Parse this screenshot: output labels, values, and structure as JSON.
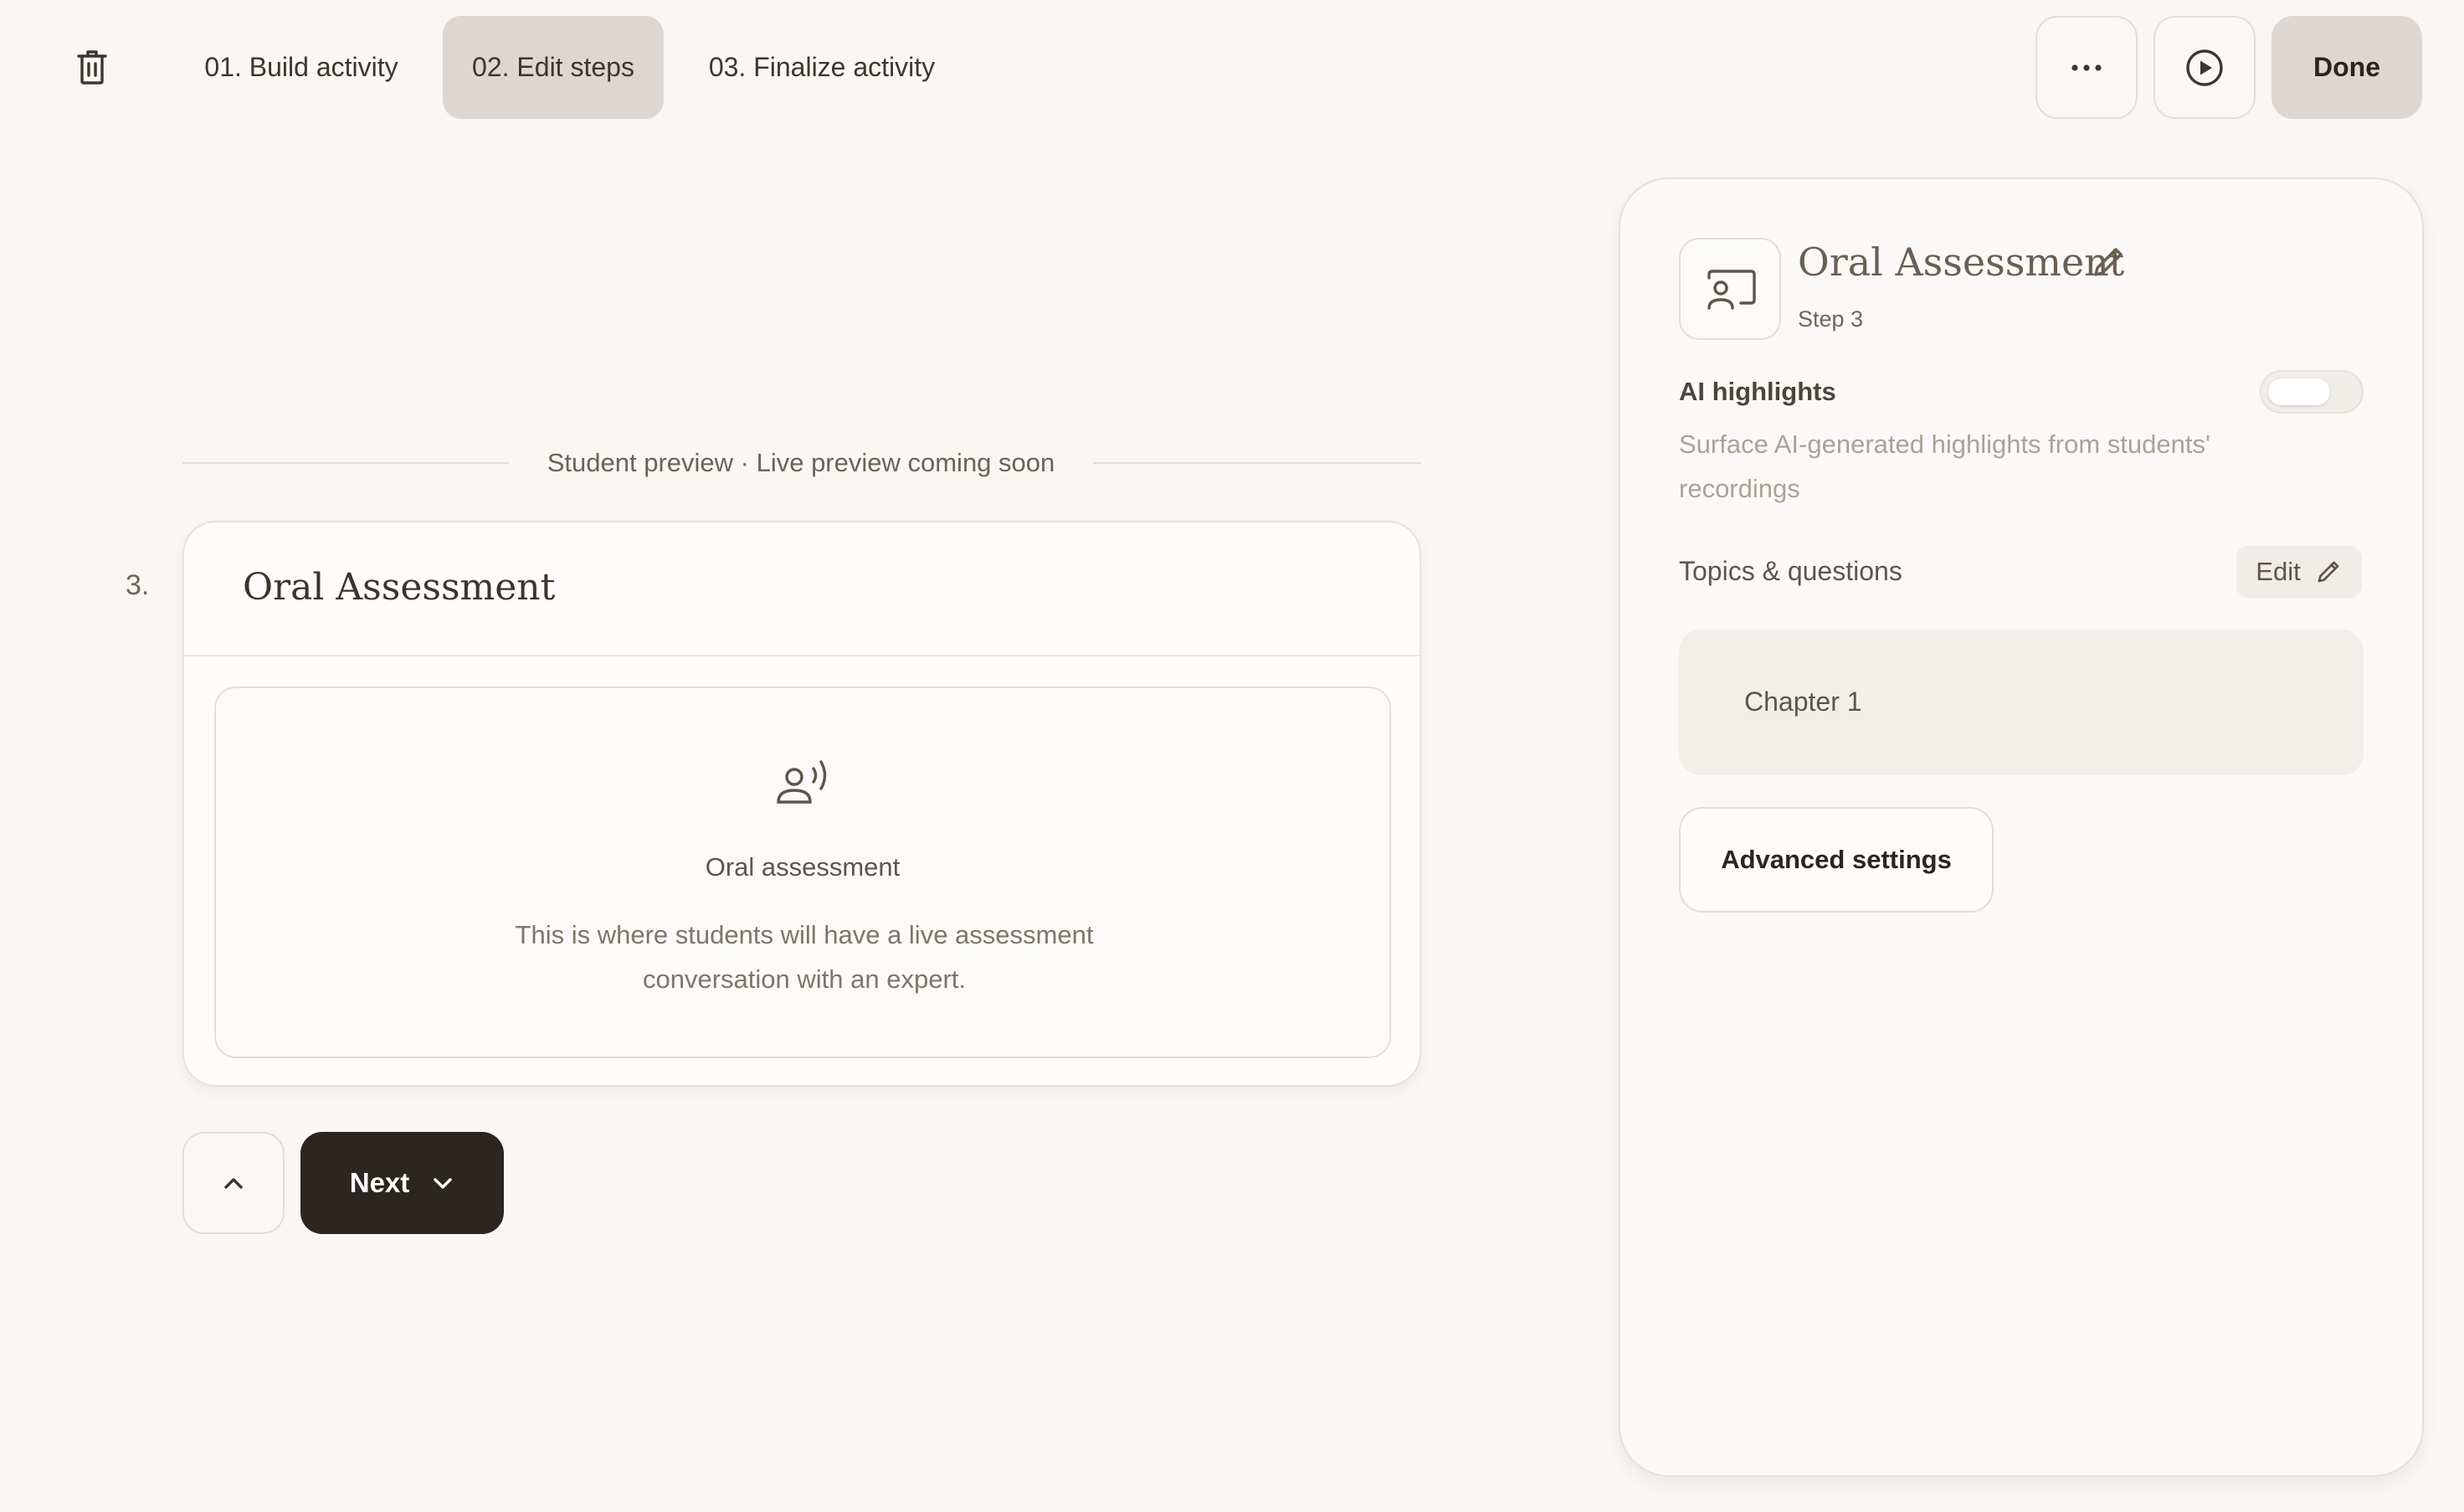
{
  "toolbar": {
    "tabs": [
      {
        "label": "01. Build activity"
      },
      {
        "label": "02. Edit steps"
      },
      {
        "label": "03. Finalize activity"
      }
    ],
    "done_label": "Done",
    "icons": [
      "trash-icon",
      "more-horizontal-icon",
      "play-circle-icon"
    ]
  },
  "preview": {
    "divider_label": "Student preview · Live preview coming soon",
    "step_number": "3.",
    "card_title": "Oral Assessment",
    "inner": {
      "icon": "speaking-person-icon",
      "title": "Oral assessment",
      "description": "This is where students will have a live assessment conversation with an expert."
    },
    "next_label": "Next"
  },
  "panel": {
    "title": "Oral Assessment",
    "step": "Step 3",
    "ai_highlights": {
      "label": "AI highlights",
      "description": "Surface AI-generated highlights from students' recordings",
      "enabled": false
    },
    "topics": {
      "label": "Topics & questions",
      "edit_label": "Edit",
      "items": [
        {
          "label": "Chapter 1"
        }
      ]
    },
    "advanced_label": "Advanced settings"
  },
  "colors": {
    "background": "#f9f6f3",
    "active_tab": "#dcd7d2",
    "primary_button": "#2b261f",
    "text": "#3c362f"
  }
}
